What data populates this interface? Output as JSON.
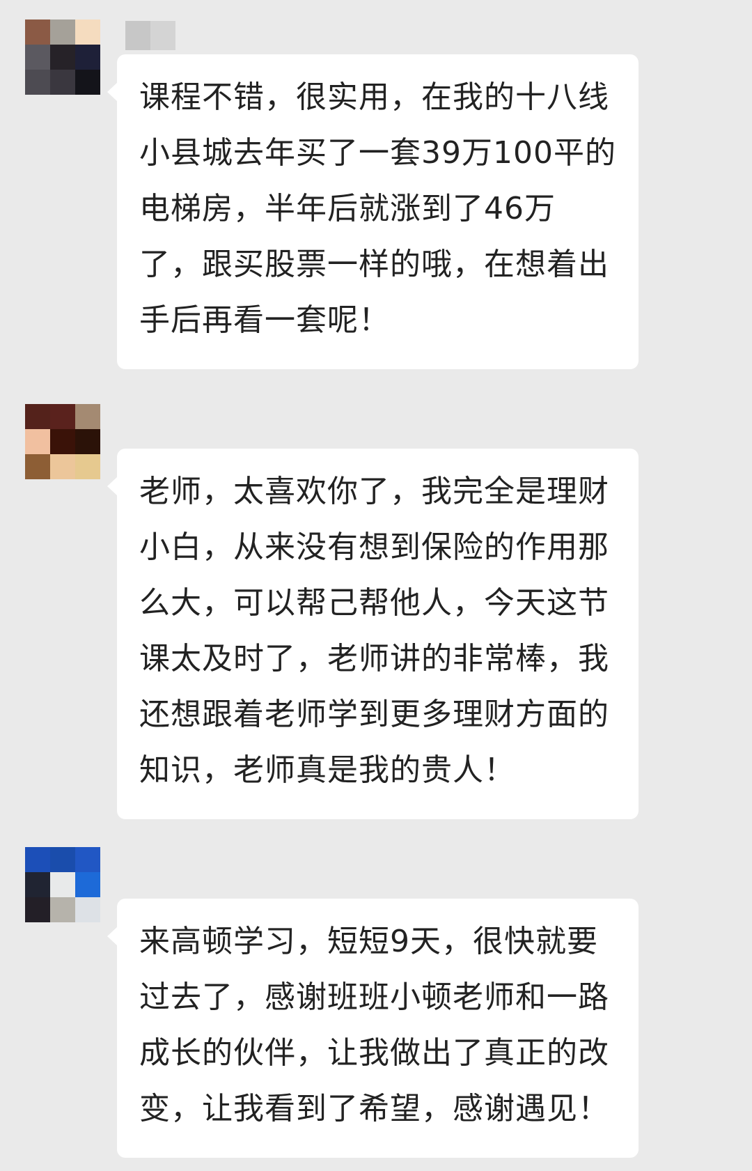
{
  "colors": {
    "background": "#eaeaea",
    "bubble": "#ffffff",
    "text": "#222222"
  },
  "messages": [
    {
      "avatar": {
        "icon": "pixelated-avatar-icon",
        "pixels": [
          "#8b5a45",
          "#a5a199",
          "#f5dcbf",
          "#5b5960",
          "#262228",
          "#1e2038",
          "#4d4b52",
          "#3a373f",
          "#14141a"
        ]
      },
      "nickname_pixels": [
        "#c7c7c7",
        "#d4d4d4"
      ],
      "text": "课程不错，很实用，在我的十八线小县城去年买了一套39万100平的电梯房，半年后就涨到了46万了，跟买股票一样的哦，在想着出手后再看一套呢！"
    },
    {
      "avatar": {
        "icon": "pixelated-avatar-icon",
        "pixels": [
          "#54221b",
          "#5a221d",
          "#a48a72",
          "#f1c0a0",
          "#3a1208",
          "#2b1208",
          "#8d5e35",
          "#ecc69a",
          "#e6c98f"
        ]
      },
      "text": "老师，太喜欢你了，我完全是理财小白，从来没有想到保险的作用那么大，可以帮己帮他人，今天这节课太及时了，老师讲的非常棒，我还想跟着老师学到更多理财方面的知识，老师真是我的贵人！"
    },
    {
      "avatar": {
        "icon": "pixelated-avatar-icon",
        "pixels": [
          "#1c4fb8",
          "#1a4dac",
          "#2157c4",
          "#202432",
          "#e8eaea",
          "#1d6ad8",
          "#231f27",
          "#b6b3ab",
          "#dde1e6"
        ]
      },
      "text": "来高顿学习，短短9天，很快就要过去了，感谢班班小顿老师和一路成长的伙伴，让我做出了真正的改变，让我看到了希望，感谢遇见！"
    }
  ]
}
